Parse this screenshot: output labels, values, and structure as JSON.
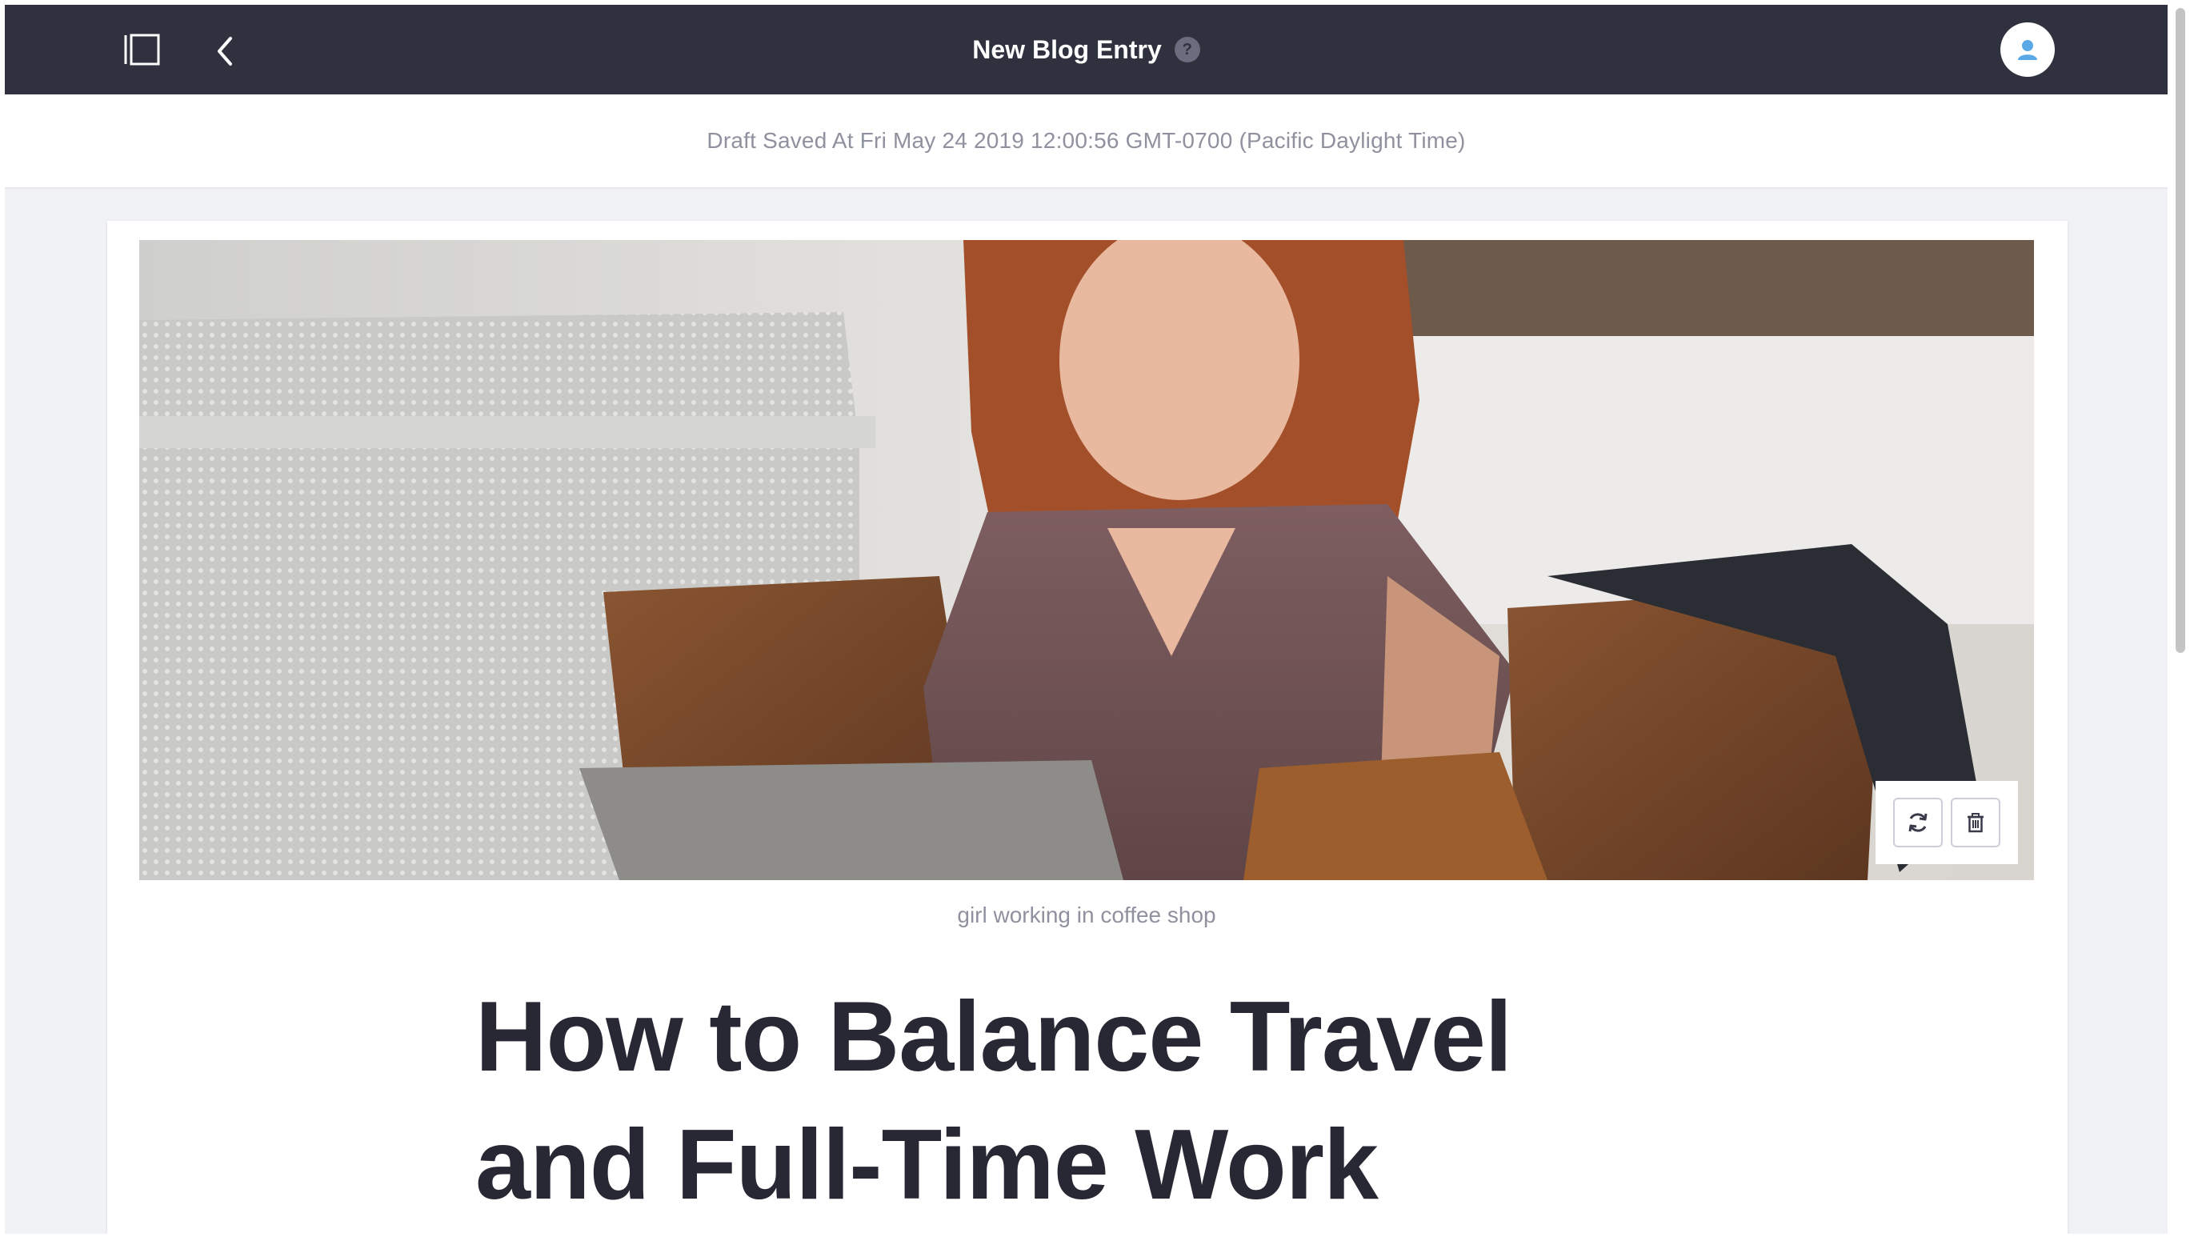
{
  "header": {
    "title": "New Blog Entry",
    "help_glyph": "?",
    "sidebar_toggle_icon": "sidebar-toggle-icon",
    "back_icon": "chevron-left-icon",
    "avatar_icon": "user-icon",
    "bar_color": "#30313f",
    "accent_color": "#5aa9e6"
  },
  "draft": {
    "status": "Draft Saved At Fri May 24 2019 12:00:56 GMT-0700 (Pacific Daylight Time)"
  },
  "entry": {
    "cover_image": {
      "description_icon": "cover-photo",
      "caption": "girl working in coffee shop",
      "tools": [
        {
          "name": "change-image",
          "icon": "refresh-icon"
        },
        {
          "name": "remove-image",
          "icon": "trash-icon"
        }
      ]
    },
    "title": "How to Balance Travel and Full-Time Work"
  }
}
